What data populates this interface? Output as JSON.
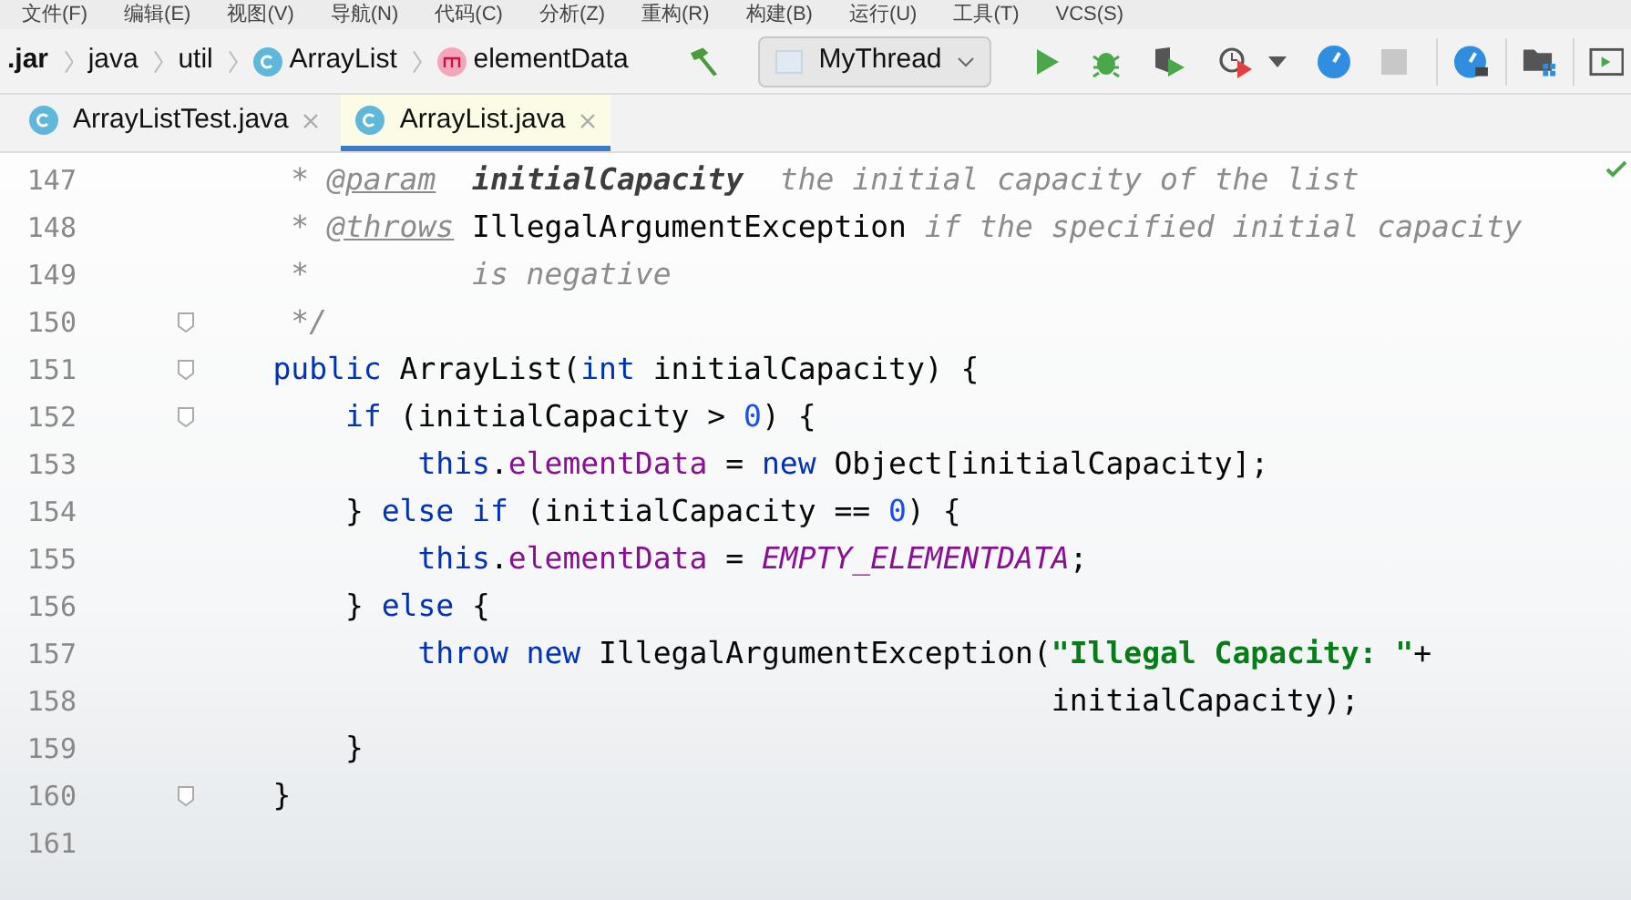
{
  "menu": [
    "文件(F)",
    "编辑(E)",
    "视图(V)",
    "导航(N)",
    "代码(C)",
    "分析(Z)",
    "重构(R)",
    "构建(B)",
    "运行(U)",
    "工具(T)",
    "VCS(S)"
  ],
  "breadcrumbs": [
    {
      "label": ".jar",
      "kind": "plain"
    },
    {
      "label": "java",
      "kind": "plain"
    },
    {
      "label": "util",
      "kind": "plain"
    },
    {
      "label": "ArrayList",
      "kind": "class"
    },
    {
      "label": "elementData",
      "kind": "method"
    }
  ],
  "run_config": {
    "label": "MyThread"
  },
  "tabs": [
    {
      "label": "ArrayListTest.java",
      "selected": false
    },
    {
      "label": "ArrayList.java",
      "selected": true
    }
  ],
  "lines": [
    {
      "number": "147",
      "fold": false,
      "tokens": [
        {
          "kind": "comment",
          "text": "     * "
        },
        {
          "kind": "doctag",
          "text": "@param"
        },
        {
          "kind": "docparam",
          "text": "  initialCapacity"
        },
        {
          "kind": "comment",
          "text": "  the initial capacity of the list"
        }
      ]
    },
    {
      "number": "148",
      "fold": false,
      "tokens": [
        {
          "kind": "comment",
          "text": "     * "
        },
        {
          "kind": "doctag",
          "text": "@throws"
        },
        {
          "kind": "plain",
          "text": " IllegalArgumentException"
        },
        {
          "kind": "comment",
          "text": " if the specified initial capacity"
        }
      ]
    },
    {
      "number": "149",
      "fold": false,
      "tokens": [
        {
          "kind": "comment",
          "text": "     *         is negative"
        }
      ]
    },
    {
      "number": "150",
      "fold": true,
      "tokens": [
        {
          "kind": "comment",
          "text": "     */"
        }
      ]
    },
    {
      "number": "151",
      "fold": true,
      "tokens": [
        {
          "kind": "keyword",
          "text": "    public"
        },
        {
          "kind": "plain",
          "text": " ArrayList("
        },
        {
          "kind": "keyword",
          "text": "int"
        },
        {
          "kind": "plain",
          "text": " initialCapacity) {"
        }
      ]
    },
    {
      "number": "152",
      "fold": true,
      "tokens": [
        {
          "kind": "keyword",
          "text": "        if"
        },
        {
          "kind": "plain",
          "text": " (initialCapacity > "
        },
        {
          "kind": "number",
          "text": "0"
        },
        {
          "kind": "plain",
          "text": ") {"
        }
      ]
    },
    {
      "number": "153",
      "fold": false,
      "tokens": [
        {
          "kind": "keyword",
          "text": "            this"
        },
        {
          "kind": "plain",
          "text": "."
        },
        {
          "kind": "field",
          "text": "elementData"
        },
        {
          "kind": "plain",
          "text": " = "
        },
        {
          "kind": "keyword",
          "text": "new"
        },
        {
          "kind": "plain",
          "text": " Object[initialCapacity];"
        }
      ]
    },
    {
      "number": "154",
      "fold": false,
      "tokens": [
        {
          "kind": "plain",
          "text": "        } "
        },
        {
          "kind": "keyword",
          "text": "else if"
        },
        {
          "kind": "plain",
          "text": " (initialCapacity == "
        },
        {
          "kind": "number",
          "text": "0"
        },
        {
          "kind": "plain",
          "text": ") {"
        }
      ]
    },
    {
      "number": "155",
      "fold": false,
      "tokens": [
        {
          "kind": "keyword",
          "text": "            this"
        },
        {
          "kind": "plain",
          "text": "."
        },
        {
          "kind": "field",
          "text": "elementData"
        },
        {
          "kind": "plain",
          "text": " = "
        },
        {
          "kind": "constant",
          "text": "EMPTY_ELEMENTDATA"
        },
        {
          "kind": "plain",
          "text": ";"
        }
      ]
    },
    {
      "number": "156",
      "fold": false,
      "tokens": [
        {
          "kind": "plain",
          "text": "        } "
        },
        {
          "kind": "keyword",
          "text": "else"
        },
        {
          "kind": "plain",
          "text": " {"
        }
      ]
    },
    {
      "number": "157",
      "fold": false,
      "tokens": [
        {
          "kind": "keyword",
          "text": "            throw new"
        },
        {
          "kind": "plain",
          "text": " IllegalArgumentException("
        },
        {
          "kind": "string",
          "text": "\"Illegal Capacity: \""
        },
        {
          "kind": "plain",
          "text": "+"
        }
      ]
    },
    {
      "number": "158",
      "fold": false,
      "tokens": [
        {
          "kind": "plain",
          "text": "                                               initialCapacity);"
        }
      ]
    },
    {
      "number": "159",
      "fold": false,
      "tokens": [
        {
          "kind": "plain",
          "text": "        }"
        }
      ]
    },
    {
      "number": "160",
      "fold": true,
      "tokens": [
        {
          "kind": "plain",
          "text": "    }"
        }
      ]
    },
    {
      "number": "161",
      "fold": false
    }
  ]
}
